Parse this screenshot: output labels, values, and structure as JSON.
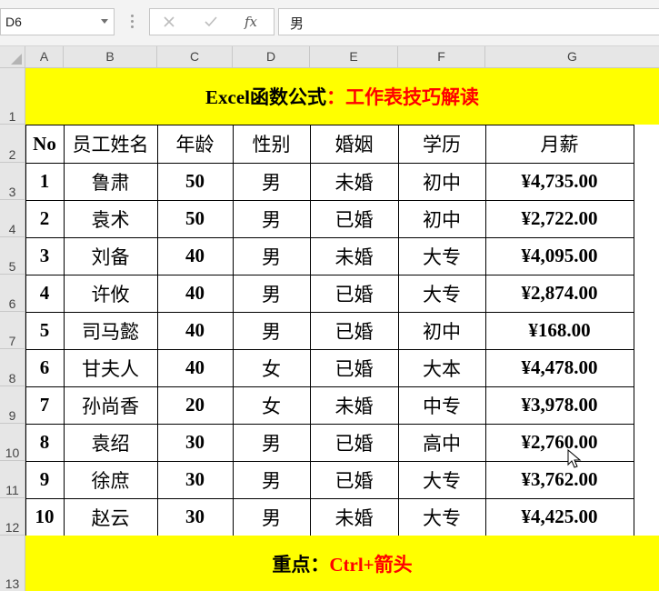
{
  "name_box": "D6",
  "formula_bar": {
    "cancel_icon": "x-icon",
    "enter_icon": "check-icon",
    "function_label": "fx",
    "value": "男"
  },
  "columns": [
    "A",
    "B",
    "C",
    "D",
    "E",
    "F",
    "G"
  ],
  "rows": [
    "1",
    "2",
    "3",
    "4",
    "5",
    "6",
    "7",
    "8",
    "9",
    "10",
    "11",
    "12",
    "13"
  ],
  "title": {
    "part1": "Excel函数公式",
    "part2": "：工作表技巧解读"
  },
  "table": {
    "headers": [
      "No",
      "员工姓名",
      "年龄",
      "性别",
      "婚姻",
      "学历",
      "月薪"
    ],
    "rows": [
      [
        "1",
        "鲁肃",
        "50",
        "男",
        "未婚",
        "初中",
        "¥4,735.00"
      ],
      [
        "2",
        "袁术",
        "50",
        "男",
        "已婚",
        "初中",
        "¥2,722.00"
      ],
      [
        "3",
        "刘备",
        "40",
        "男",
        "未婚",
        "大专",
        "¥4,095.00"
      ],
      [
        "4",
        "许攸",
        "40",
        "男",
        "已婚",
        "大专",
        "¥2,874.00"
      ],
      [
        "5",
        "司马懿",
        "40",
        "男",
        "已婚",
        "初中",
        "¥168.00"
      ],
      [
        "6",
        "甘夫人",
        "40",
        "女",
        "已婚",
        "大本",
        "¥4,478.00"
      ],
      [
        "7",
        "孙尚香",
        "20",
        "女",
        "未婚",
        "中专",
        "¥3,978.00"
      ],
      [
        "8",
        "袁绍",
        "30",
        "男",
        "已婚",
        "高中",
        "¥2,760.00"
      ],
      [
        "9",
        "徐庶",
        "30",
        "男",
        "已婚",
        "大专",
        "¥3,762.00"
      ],
      [
        "10",
        "赵云",
        "30",
        "男",
        "未婚",
        "大专",
        "¥4,425.00"
      ]
    ]
  },
  "footer": {
    "part1": "重点：",
    "part2": "Ctrl+箭头"
  },
  "colors": {
    "banner_bg": "#ffff00",
    "accent_red": "#ff0000",
    "header_bg": "#e6e6e6"
  }
}
